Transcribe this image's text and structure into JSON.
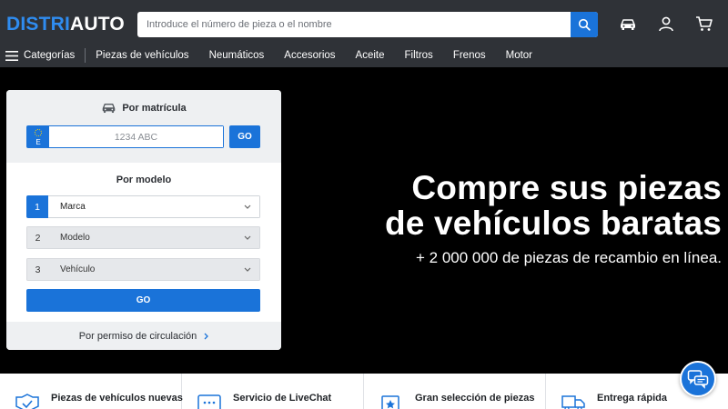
{
  "header": {
    "logo_part1": "DISTRI",
    "logo_part2": "AUTO",
    "search_placeholder": "Introduce el número de pieza o el nombre"
  },
  "nav": {
    "categories_label": "Categorías",
    "items": [
      "Piezas de vehículos",
      "Neumáticos",
      "Accesorios",
      "Aceite",
      "Filtros",
      "Frenos",
      "Motor"
    ]
  },
  "form": {
    "plate_title": "Por matrícula",
    "plate_country": "E",
    "plate_placeholder": "1234 ABC",
    "go_label": "GO",
    "model_title": "Por modelo",
    "selects": [
      {
        "num": "1",
        "label": "Marca"
      },
      {
        "num": "2",
        "label": "Modelo"
      },
      {
        "num": "3",
        "label": "Vehículo"
      }
    ],
    "go_wide_label": "GO",
    "permit_link": "Por permiso de circulación"
  },
  "hero": {
    "line1": "Compre sus piezas",
    "line2": "de vehículos baratas",
    "subtitle": "+ 2 000 000 de piezas de recambio en línea."
  },
  "features": [
    {
      "title": "Piezas de vehículos nuevas"
    },
    {
      "title": "Servicio de LiveChat"
    },
    {
      "title": "Gran selección de piezas"
    },
    {
      "title": "Entrega rápida"
    }
  ],
  "colors": {
    "brand_blue": "#1a73d9",
    "header_bg": "#2f3237",
    "hero_bg": "#000000"
  }
}
